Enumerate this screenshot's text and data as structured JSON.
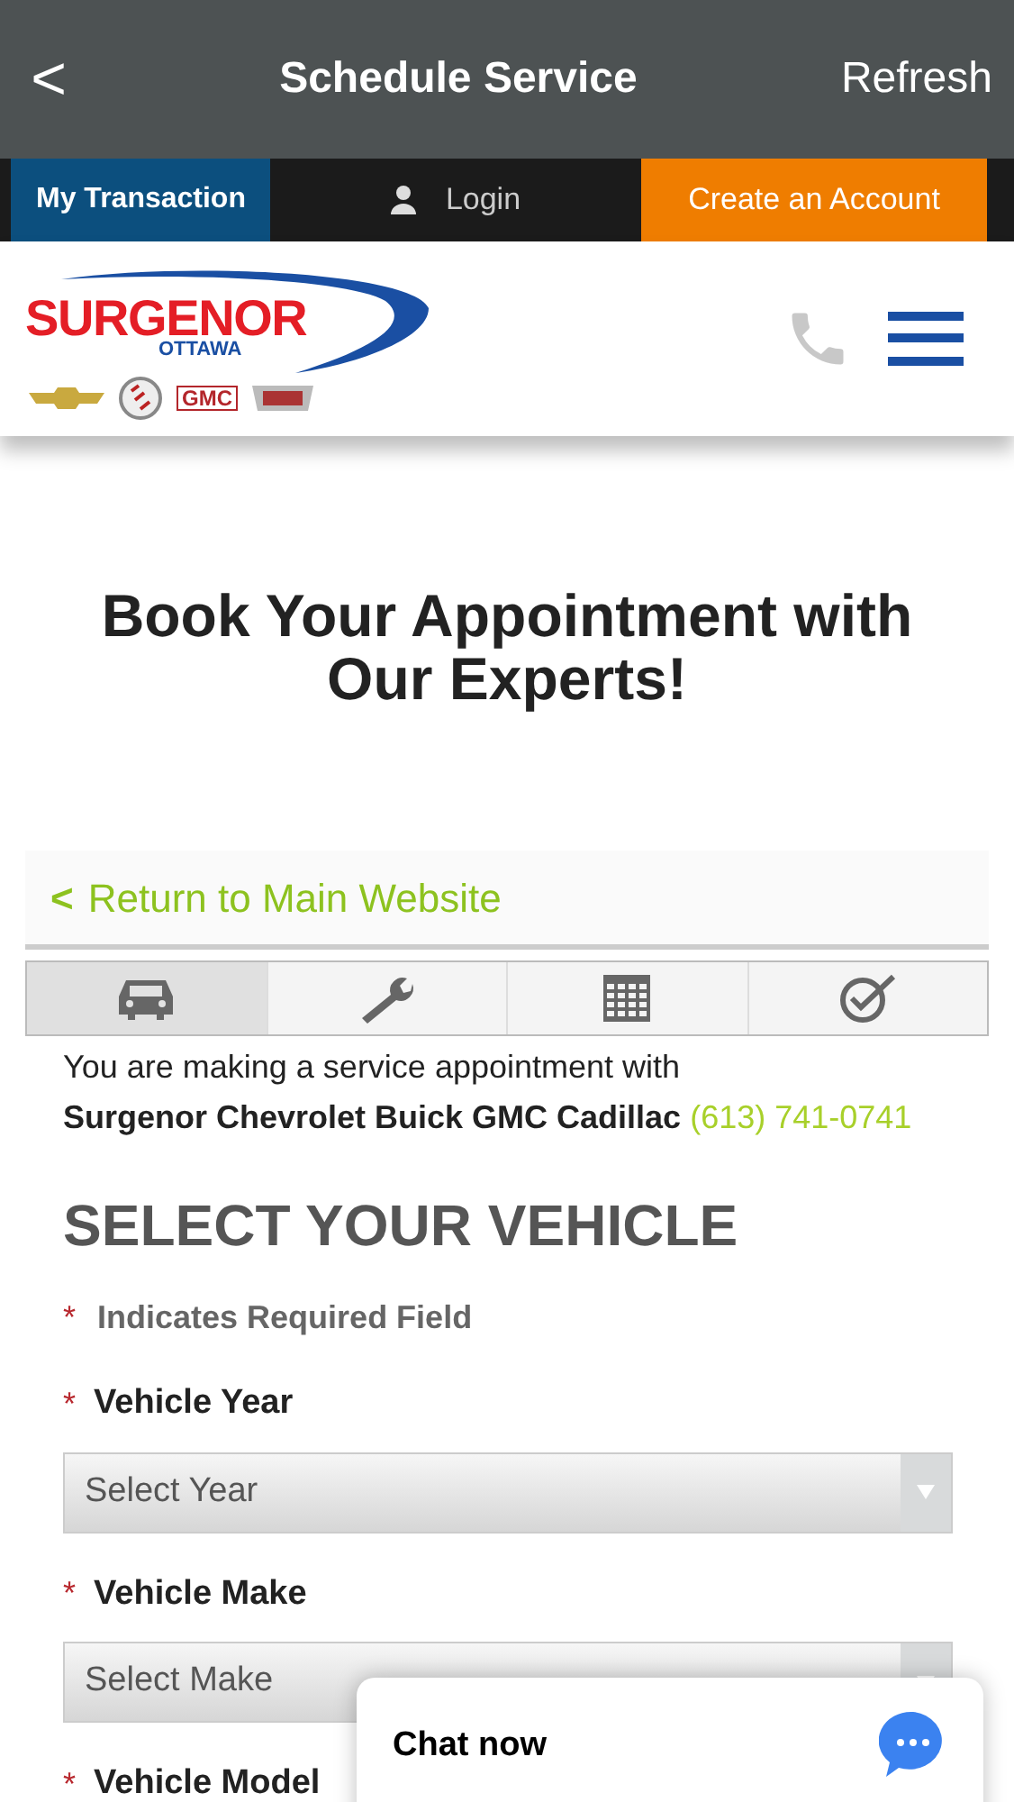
{
  "app_bar": {
    "back": "<",
    "title": "Schedule Service",
    "refresh": "Refresh"
  },
  "top_nav": {
    "transaction": "My Transaction",
    "login": "Login",
    "create_account": "Create an Account"
  },
  "logo": {
    "name": "SURGENOR",
    "city": "OTTAWA",
    "brand": "GMC"
  },
  "heading": "Book Your Appointment with Our Experts!",
  "return_link": {
    "icon": "<",
    "label": "Return to Main Website"
  },
  "steps": [
    {
      "kind": "car",
      "selected": true
    },
    {
      "kind": "wrench",
      "selected": false
    },
    {
      "kind": "calendar",
      "selected": false
    },
    {
      "kind": "check",
      "selected": false
    }
  ],
  "intro": {
    "text": "You are making a service appointment with",
    "dealer": "Surgenor Chevrolet Buick GMC Cadillac",
    "phone": "(613) 741-0741"
  },
  "section_title": "SELECT YOUR VEHICLE",
  "required_note": {
    "mark": "*",
    "text": "Indicates Required Field"
  },
  "fields": [
    {
      "mark": "*",
      "label": "Vehicle Year",
      "placeholder": "Select Year"
    },
    {
      "mark": "*",
      "label": "Vehicle Make",
      "placeholder": "Select Make"
    },
    {
      "mark": "*",
      "label": "Vehicle Model"
    }
  ],
  "chat": {
    "label": "Chat now"
  }
}
